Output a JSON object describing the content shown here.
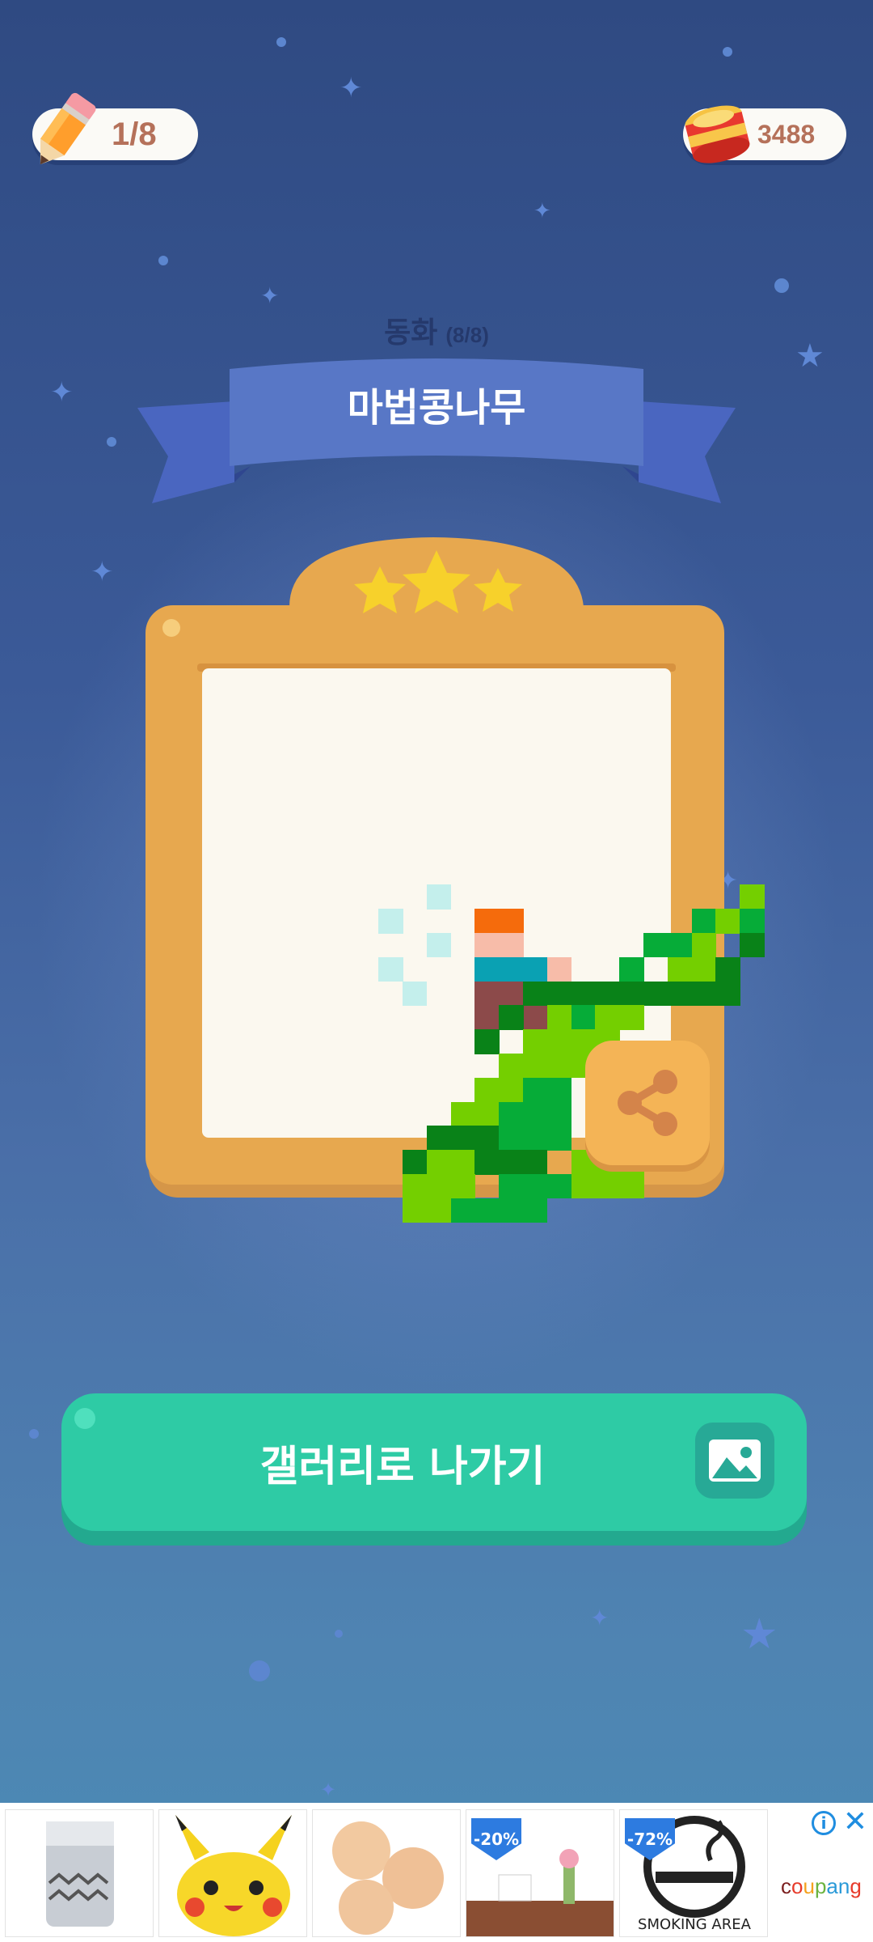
{
  "hud": {
    "pencils": "1/8",
    "coins": "3488"
  },
  "category": {
    "name": "동화",
    "count": "(8/8)"
  },
  "puzzle": {
    "title": "마법콩나무",
    "stars": 3
  },
  "gallery_button": {
    "label": "갤러리로 나가기"
  },
  "ad": {
    "discount_1": "-20%",
    "discount_2": "-72%",
    "smoking_label": "SMOKING AREA",
    "brand": "coupang"
  },
  "icons": [
    "pencil-icon",
    "cat-food-can-icon",
    "star-icon",
    "share-icon",
    "gallery-image-icon",
    "info-icon",
    "close-icon"
  ]
}
